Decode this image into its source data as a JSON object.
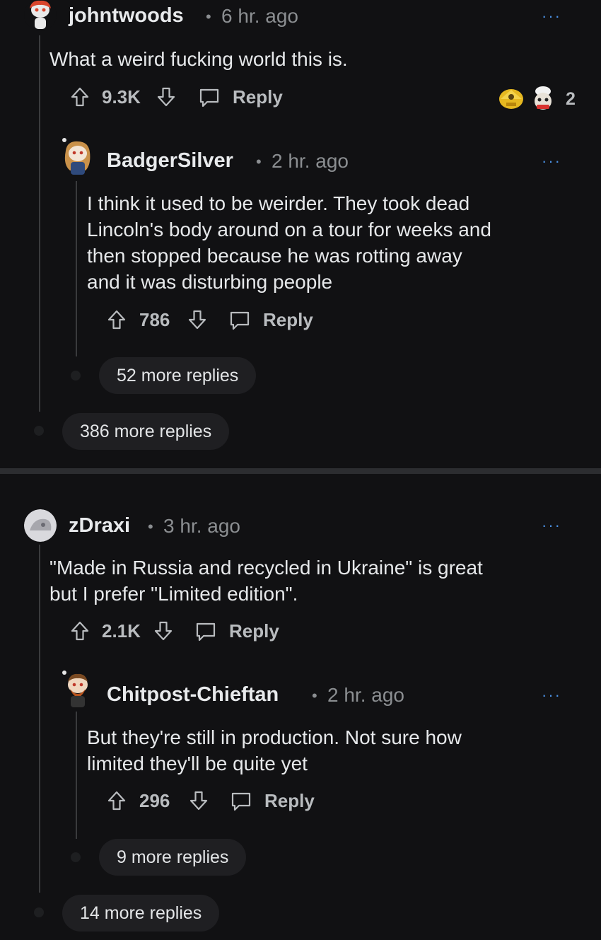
{
  "comments": [
    {
      "username": "johntwoods",
      "time": "6 hr. ago",
      "text": "What a weird fucking world this is.",
      "score": "9.3K",
      "reply_label": "Reply",
      "award_count": "2",
      "reply": {
        "username": "BadgerSilver",
        "time": "2 hr. ago",
        "lines": [
          "I think it used to be weirder. They took dead",
          "Lincoln's body around on a tour for weeks and",
          "then stopped because he was rotting away",
          "and it was disturbing people"
        ],
        "score": "786",
        "reply_label": "Reply",
        "more_replies": "52 more replies"
      },
      "more_replies": "386 more replies"
    },
    {
      "username": "zDraxi",
      "time": "3 hr. ago",
      "lines": [
        "\"Made in Russia and recycled in Ukraine\" is great",
        "but I prefer \"Limited edition\"."
      ],
      "score": "2.1K",
      "reply_label": "Reply",
      "reply": {
        "username": "Chitpost-Chieftan",
        "time": "2 hr. ago",
        "lines": [
          "But they're still in production. Not sure how",
          "limited they'll be quite yet"
        ],
        "score": "296",
        "reply_label": "Reply",
        "more_replies": "9 more replies"
      },
      "more_replies": "14 more replies"
    }
  ],
  "separator": "•",
  "overflow_glyph": "···",
  "colors": {
    "background": "#111113",
    "text": "#e6e8ea",
    "muted": "#8b8e91",
    "link": "#4a90e2"
  }
}
